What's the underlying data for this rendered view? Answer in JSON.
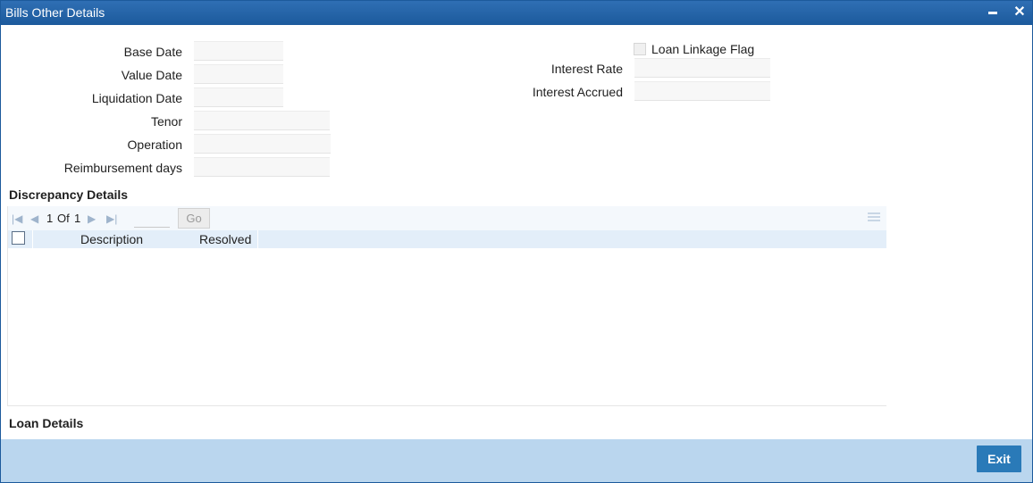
{
  "window": {
    "title": "Bills Other Details",
    "minimize_icon": "minimize-icon",
    "close_icon": "close-icon"
  },
  "form": {
    "base_date_label": "Base Date",
    "base_date_value": "",
    "value_date_label": "Value Date",
    "value_date_value": "",
    "liquidation_date_label": "Liquidation Date",
    "liquidation_date_value": "",
    "tenor_label": "Tenor",
    "tenor_value": "",
    "operation_label": "Operation",
    "operation_value": "",
    "reimbursement_days_label": "Reimbursement days",
    "reimbursement_days_value": "",
    "loan_linkage_flag_label": "Loan Linkage Flag",
    "loan_linkage_flag_checked": false,
    "interest_rate_label": "Interest Rate",
    "interest_rate_value": "",
    "interest_accrued_label": "Interest Accrued",
    "interest_accrued_value": ""
  },
  "discrepancy": {
    "title": "Discrepancy Details",
    "pagination": {
      "current": "1",
      "of_label": "Of",
      "total": "1",
      "go_label": "Go"
    },
    "columns": [
      "Description",
      "Resolved"
    ],
    "rows": []
  },
  "loan": {
    "title": "Loan Details"
  },
  "footer": {
    "exit_label": "Exit"
  },
  "colors": {
    "titlebar": "#1c5a9c",
    "footer": "#bad6ee",
    "exit_button": "#2a7ab8",
    "grid_header": "#e3eef9"
  }
}
